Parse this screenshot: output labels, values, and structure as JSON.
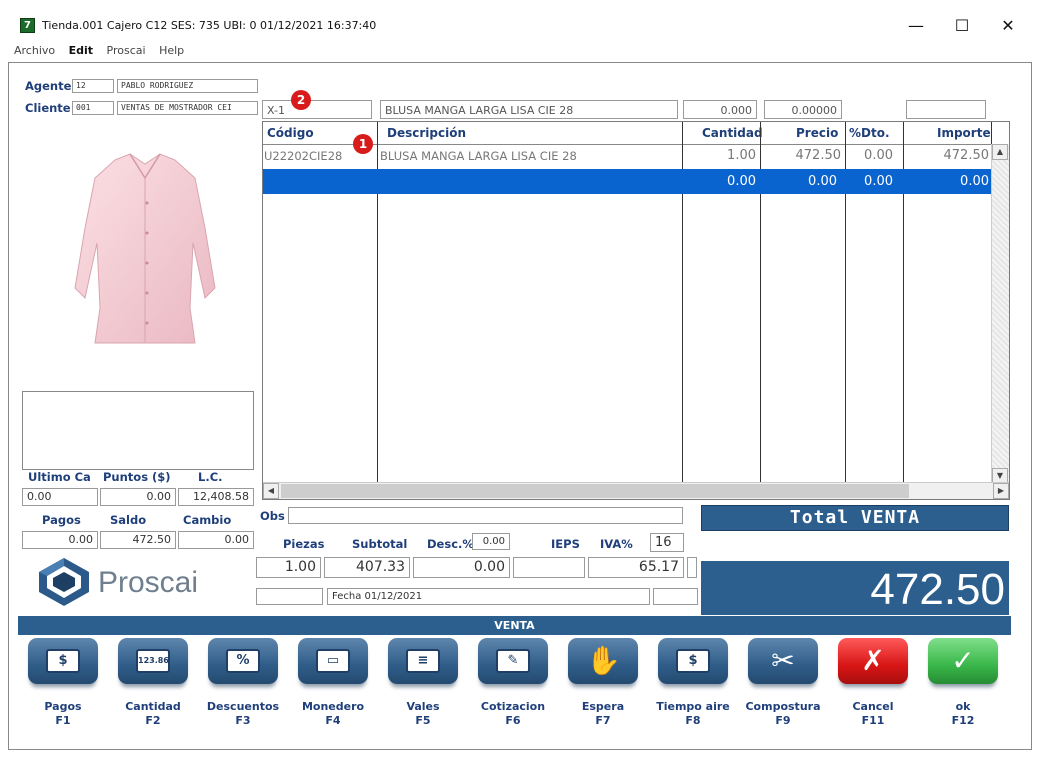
{
  "window": {
    "title": "Tienda.001  Cajero C12     SES: 735   UBI: 0   01/12/2021 16:37:40",
    "app_icon": "7",
    "minimize": "—",
    "maximize": "☐",
    "close": "✕"
  },
  "menu": {
    "items": [
      "Archivo",
      "Edit",
      "Proscai",
      "Help"
    ]
  },
  "customer": {
    "agente_label": "Agente",
    "agente_code": "12",
    "agente_name": "PABLO RODRIGUEZ",
    "cliente_label": "Cliente",
    "cliente_code": "001",
    "cliente_name": "VENTAS DE MOSTRADOR CEI"
  },
  "input_row": {
    "code": "X-1",
    "description": "BLUSA MANGA LARGA LISA CIE 28",
    "qty": "0.000",
    "price": "0.00000",
    "extra": ""
  },
  "grid": {
    "headers": [
      "Código",
      "Descripción",
      "Cantidad",
      "Precio",
      "%Dto.",
      "Importe"
    ],
    "rows": [
      {
        "codigo": "U22202CIE28",
        "descripcion": "BLUSA MANGA LARGA LISA CIE 28",
        "cantidad": "1.00",
        "precio": "472.50",
        "dto": "0.00",
        "importe": "472.50"
      }
    ],
    "selected_row": {
      "cantidad": "0.00",
      "precio": "0.00",
      "dto": "0.00",
      "importe": "0.00"
    }
  },
  "badges": {
    "one": "1",
    "two": "2"
  },
  "stats": {
    "ultimo_label": "Ultimo Ca",
    "puntos_label": "Puntos ($)",
    "lc_label": "L.C.",
    "ultimo": "0.00",
    "puntos": "0.00",
    "lc": "12,408.58",
    "pagos_label": "Pagos",
    "saldo_label": "Saldo",
    "cambio_label": "Cambio",
    "pagos": "0.00",
    "saldo": "472.50",
    "cambio": "0.00"
  },
  "obs_label": "Obs",
  "totals": {
    "piezas_label": "Piezas",
    "subtotal_label": "Subtotal",
    "desc_label": "Desc.%",
    "desc_pct": "0.00",
    "ieps_label": "IEPS",
    "iva_label": "IVA%",
    "iva_pct": "16",
    "piezas": "1.00",
    "subtotal": "407.33",
    "descuento": "0.00",
    "ieps": "",
    "iva": "65.17",
    "fecha": "Fecha 01/12/2021",
    "total_label": "Total VENTA",
    "total_value": "472.50"
  },
  "logo": {
    "text": "Proscai"
  },
  "venta_bar": "VENTA",
  "buttons": [
    {
      "label": "Pagos",
      "key": "F1",
      "icon": "payment-icon",
      "glyph": "$"
    },
    {
      "label": "Cantidad",
      "key": "F2",
      "icon": "keypad-icon",
      "glyph": "123.86"
    },
    {
      "label": "Descuentos",
      "key": "F3",
      "icon": "discount-icon",
      "glyph": "%"
    },
    {
      "label": "Monedero",
      "key": "F4",
      "icon": "wallet-icon",
      "glyph": "▭"
    },
    {
      "label": "Vales",
      "key": "F5",
      "icon": "voucher-icon",
      "glyph": "≡"
    },
    {
      "label": "Cotizacion",
      "key": "F6",
      "icon": "quote-icon",
      "glyph": "✎"
    },
    {
      "label": "Espera",
      "key": "F7",
      "icon": "hand-icon",
      "glyph": "✋"
    },
    {
      "label": "Tiempo aire",
      "key": "F8",
      "icon": "phone-icon",
      "glyph": "$"
    },
    {
      "label": "Compostura",
      "key": "F9",
      "icon": "scissors-icon",
      "glyph": "✂"
    },
    {
      "label": "Cancel",
      "key": "F11",
      "icon": "cancel-icon",
      "glyph": "✗"
    },
    {
      "label": "ok",
      "key": "F12",
      "icon": "ok-icon",
      "glyph": "✓"
    }
  ],
  "colors": {
    "accent": "#2c5e8e",
    "selection": "#0a64cf",
    "label": "#1f3f7a",
    "cancel": "#d81515",
    "ok": "#39b649"
  }
}
